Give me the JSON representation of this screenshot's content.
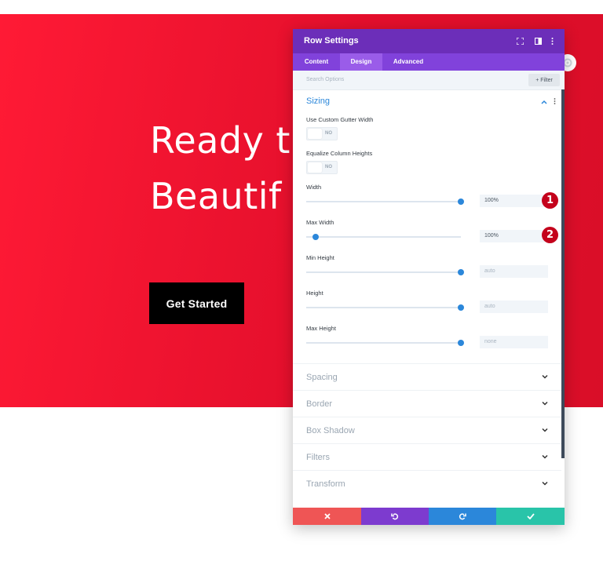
{
  "page": {
    "hero_line1": "Ready t",
    "hero_line2": "Beautif",
    "cta_label": "Get Started"
  },
  "panel": {
    "title": "Row Settings",
    "header_icons": [
      "fullscreen-icon",
      "columns-icon",
      "more-vertical-icon"
    ],
    "tabs": [
      {
        "label": "Content",
        "active": false
      },
      {
        "label": "Design",
        "active": true
      },
      {
        "label": "Advanced",
        "active": false
      }
    ],
    "search_placeholder": "Search Options",
    "filter_label": "+ Filter",
    "sizing": {
      "title": "Sizing",
      "custom_gutter": {
        "label": "Use Custom Gutter Width",
        "value": "NO"
      },
      "equalize_heights": {
        "label": "Equalize Column Heights",
        "value": "NO"
      },
      "width": {
        "label": "Width",
        "value": "100%",
        "level": 1.0,
        "badge": "1"
      },
      "max_width": {
        "label": "Max Width",
        "value": "100%",
        "level": 0.06,
        "badge": "2"
      },
      "min_height": {
        "label": "Min Height",
        "value": "auto",
        "level": 1.0
      },
      "height": {
        "label": "Height",
        "value": "auto",
        "level": 1.0
      },
      "max_height": {
        "label": "Max Height",
        "value": "none",
        "level": 1.0
      }
    },
    "collapsed_groups": [
      "Spacing",
      "Border",
      "Box Shadow",
      "Filters",
      "Transform"
    ],
    "footer_actions": [
      {
        "name": "cancel",
        "icon": "close-icon",
        "color": "#ef5555"
      },
      {
        "name": "undo",
        "icon": "undo-icon",
        "color": "#7d3bcf"
      },
      {
        "name": "redo",
        "icon": "redo-icon",
        "color": "#2b87da"
      },
      {
        "name": "save",
        "icon": "check-icon",
        "color": "#29c4a9"
      }
    ]
  },
  "colors": {
    "hero_red": "#e40f2c",
    "panel_header": "#6c2eb9",
    "tab_bar": "#8142db",
    "accent_blue": "#2b87da",
    "badge_red": "#c4021c"
  }
}
